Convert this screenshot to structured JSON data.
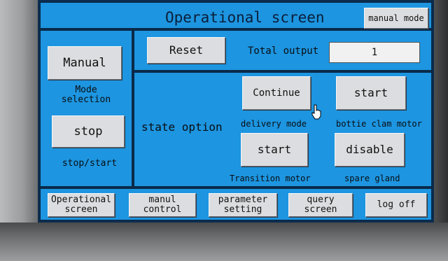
{
  "header": {
    "title": "Operational screen",
    "mode_button": "manual mode"
  },
  "left_panel": {
    "mode_button": "Manual",
    "mode_label": "Mode\nselection",
    "stop_button": "stop",
    "stop_label": "stop/start"
  },
  "top_row": {
    "reset_button": "Reset",
    "total_output_label": "Total output",
    "total_output_value": "1"
  },
  "state_panel": {
    "state_label": "state option",
    "delivery": {
      "button": "Continue",
      "caption": "delivery mode"
    },
    "bottle_clam": {
      "button": "start",
      "caption": "bottie clam motor"
    },
    "transition": {
      "button": "start",
      "caption": "Transition motor"
    },
    "spare_gland": {
      "button": "disable",
      "caption": "spare gland"
    }
  },
  "nav": [
    {
      "label": "Operational\nscreen"
    },
    {
      "label": "manul\ncontrol"
    },
    {
      "label": "parameter\nsetting"
    },
    {
      "label": "query\nscreen"
    },
    {
      "label": "log off"
    }
  ]
}
